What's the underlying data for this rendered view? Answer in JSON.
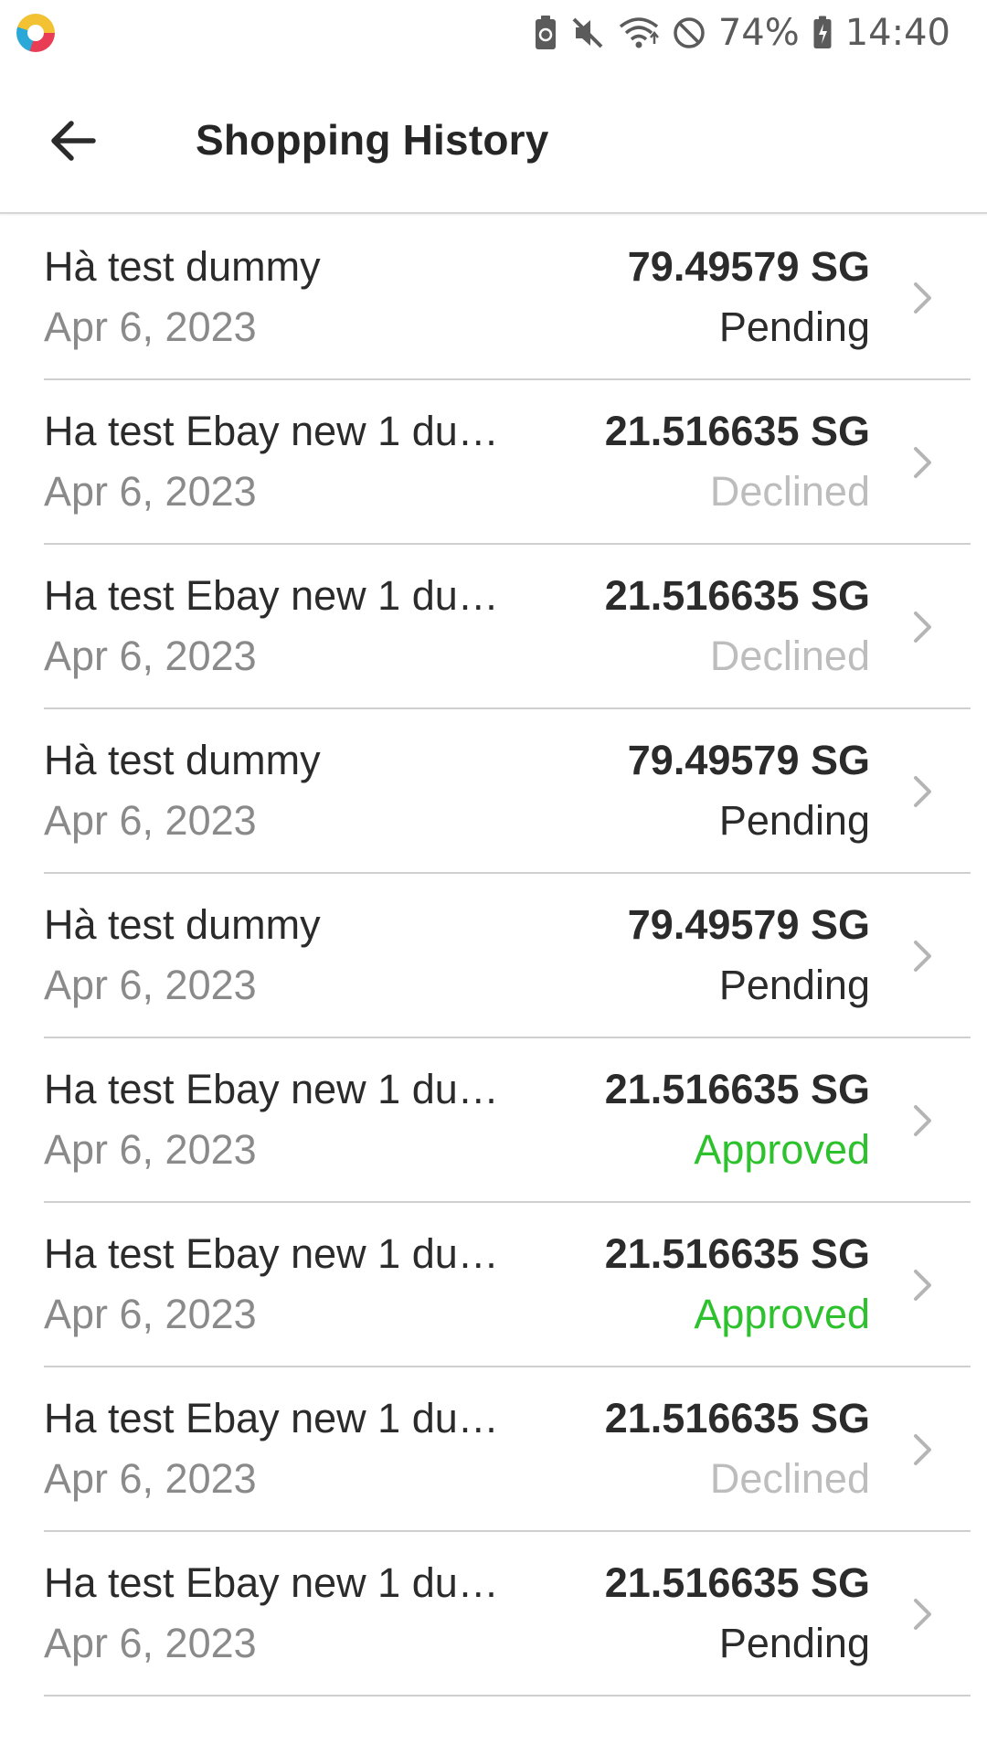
{
  "status_bar": {
    "battery_percent": "74%",
    "time": "14:40",
    "icons": [
      "app-logo-icon",
      "battery-saver-icon",
      "mute-icon",
      "wifi-icon",
      "do-not-disturb-icon",
      "battery-icon"
    ]
  },
  "header": {
    "title": "Shopping History",
    "back_icon": "arrow-left-icon"
  },
  "colors": {
    "pending": "#2b2b2b",
    "declined": "#bdbdbd",
    "approved": "#2ec12e"
  },
  "rows": [
    {
      "name": "Hà test dummy",
      "date": "Apr 6, 2023",
      "amount": "79.49579 SG",
      "status": "Pending",
      "status_type": "pending"
    },
    {
      "name": "Ha test Ebay new 1 du…",
      "date": "Apr 6, 2023",
      "amount": "21.516635 SG",
      "status": "Declined",
      "status_type": "declined"
    },
    {
      "name": "Ha test Ebay new 1 du…",
      "date": "Apr 6, 2023",
      "amount": "21.516635 SG",
      "status": "Declined",
      "status_type": "declined"
    },
    {
      "name": "Hà test dummy",
      "date": "Apr 6, 2023",
      "amount": "79.49579 SG",
      "status": "Pending",
      "status_type": "pending"
    },
    {
      "name": "Hà test dummy",
      "date": "Apr 6, 2023",
      "amount": "79.49579 SG",
      "status": "Pending",
      "status_type": "pending"
    },
    {
      "name": "Ha test Ebay new 1 du…",
      "date": "Apr 6, 2023",
      "amount": "21.516635 SG",
      "status": "Approved",
      "status_type": "approved"
    },
    {
      "name": "Ha test Ebay new 1 du…",
      "date": "Apr 6, 2023",
      "amount": "21.516635 SG",
      "status": "Approved",
      "status_type": "approved"
    },
    {
      "name": "Ha test Ebay new 1 du…",
      "date": "Apr 6, 2023",
      "amount": "21.516635 SG",
      "status": "Declined",
      "status_type": "declined"
    },
    {
      "name": "Ha test Ebay new 1 du…",
      "date": "Apr 6, 2023",
      "amount": "21.516635 SG",
      "status": "Pending",
      "status_type": "pending"
    }
  ]
}
